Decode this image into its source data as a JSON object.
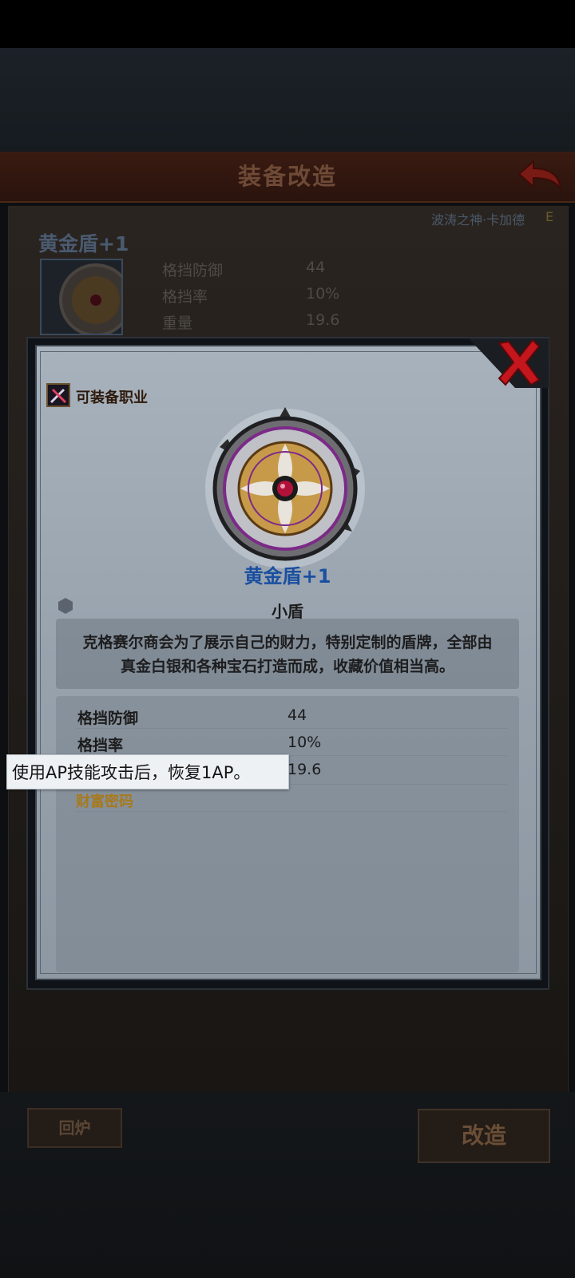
{
  "header": {
    "title": "装备改造"
  },
  "hero": {
    "name": "波涛之神·卡加德",
    "grade": "E"
  },
  "background_item": {
    "name": "黄金盾+1",
    "stats": [
      {
        "label": "格挡防御",
        "value": "44"
      },
      {
        "label": "格挡率",
        "value": "10%"
      },
      {
        "label": "重量",
        "value": "19.6"
      }
    ]
  },
  "modal": {
    "class_label": "可装备职业",
    "item_name": "黄金盾+1",
    "item_type": "小盾",
    "description": "克格赛尔商会为了展示自己的财力，特别定制的盾牌，全部由真金白银和各种宝石打造而成，收藏价值相当高。",
    "stats": [
      {
        "label": "格挡防御",
        "value": "44"
      },
      {
        "label": "格挡率",
        "value": "10%"
      },
      {
        "label": "",
        "value": "19.6"
      }
    ],
    "skill_name": "财富密码",
    "tooltip": "使用AP技能攻击后，恢复1AP。"
  },
  "footer": {
    "recycle_label": "回炉",
    "forge_label": "改造"
  },
  "colors": {
    "accent_red": "#c4161c",
    "title_blue": "#1a4fa0",
    "skill_gold": "#a77a1c"
  },
  "icons": [
    "back-arrow-icon",
    "close-x-icon",
    "class-weapon-icon",
    "hexagon-icon",
    "gold-shield-icon"
  ]
}
